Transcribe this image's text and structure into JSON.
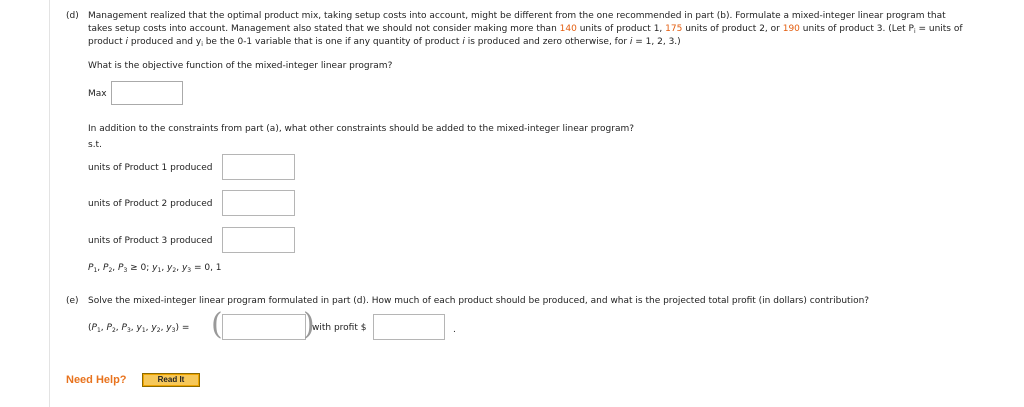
{
  "part_d": {
    "label": "(d)",
    "line1": "Management realized that the optimal product mix, taking setup costs into account, might be different from the one recommended in part (b). Formulate a mixed-integer linear program that",
    "line2_a": "takes setup costs into account. Management also stated that we should not consider making more than ",
    "limit1": "140",
    "line2_b": " units of product 1, ",
    "limit2": "175",
    "line2_c": " units of product 2, or ",
    "limit3": "190",
    "line2_d": " units of product 3. (Let P",
    "line2_sub": "i",
    "line2_e": " = units of",
    "line3_a": "product ",
    "line3_i1": "i",
    "line3_b": " produced and y",
    "line3_sub": "i",
    "line3_c": " be the 0-1 variable that is one if any quantity of product ",
    "line3_i2": "i",
    "line3_d": " is produced and zero otherwise, for ",
    "line3_i3": "i",
    "line3_e": " = 1, 2, 3.)",
    "objective_question": "What is the objective function of the mixed-integer linear program?",
    "max_label": "Max",
    "max_value": "",
    "constraints_question": "In addition to the constraints from part (a), what other constraints should be added to the mixed-integer linear program?",
    "st_label": "s.t.",
    "constraints": [
      {
        "label": "units of Product 1 produced",
        "value": ""
      },
      {
        "label": "units of Product 2 produced",
        "value": ""
      },
      {
        "label": "units of Product 3 produced",
        "value": ""
      }
    ],
    "nonneg": {
      "p": "P",
      "s1": "1",
      "s2": "2",
      "s3": "3",
      "mid": " ≥ 0; ",
      "y": "y",
      "end": " = 0, 1",
      "sep": ", "
    }
  },
  "part_e": {
    "label": "(e)",
    "question": "Solve the mixed-integer linear program formulated in part (d). How much of each product should be produced, and what is the projected total profit (in dollars) contribution?",
    "tuple_open": "(",
    "tuple_close": ") =",
    "p": "P",
    "y": "y",
    "sep": ", ",
    "solution_value": "",
    "with_profit": "with profit $",
    "profit_value": "",
    "period": "."
  },
  "help": {
    "need_help": "Need Help?",
    "read_it": "Read It"
  },
  "colors": {
    "highlight": "#e35d0f",
    "need_help": "#e8731e",
    "read_it_button": "#f0a500"
  }
}
